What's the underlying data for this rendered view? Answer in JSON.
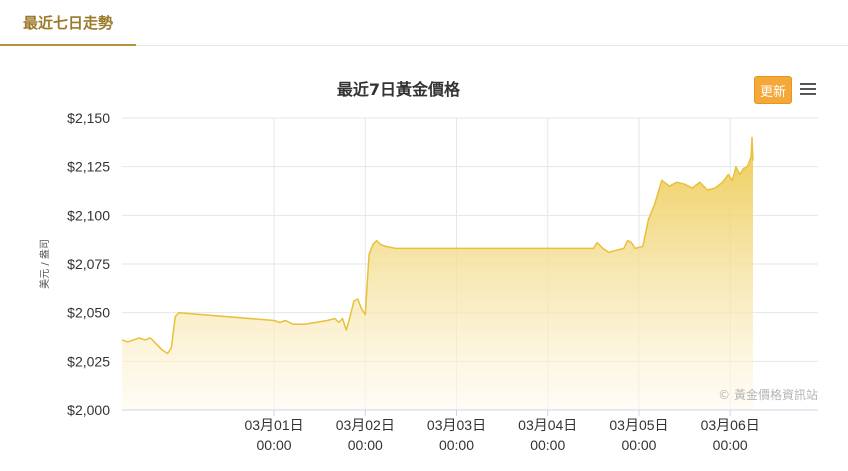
{
  "tab": {
    "label": "最近七日走勢"
  },
  "toolbar": {
    "update_label": "更新",
    "menu_icon": "hamburger-menu-icon"
  },
  "credits": "© 黃金價格資訊站",
  "colors": {
    "line": "#e8c13a",
    "fill_top": "#ecc84a",
    "fill_bottom": "#fffaf0",
    "accent": "#f4a83a",
    "tab": "#b8913a"
  },
  "chart_data": {
    "type": "area",
    "title": "最近7日黃金價格",
    "ylabel": "美元 / 盎司",
    "xlabel": "",
    "ylim": [
      2000,
      2150
    ],
    "yticks": [
      {
        "value": 2000,
        "label": "$2,000"
      },
      {
        "value": 2025,
        "label": "$2,025"
      },
      {
        "value": 2050,
        "label": "$2,050"
      },
      {
        "value": 2075,
        "label": "$2,075"
      },
      {
        "value": 2100,
        "label": "$2,100"
      },
      {
        "value": 2125,
        "label": "$2,125"
      },
      {
        "value": 2150,
        "label": "$2,150"
      }
    ],
    "xlim": [
      "02-29 08:00",
      "03-06 06:00"
    ],
    "xticks": [
      {
        "value": "03-01 00:00",
        "line1": "03月01日",
        "line2": "00:00"
      },
      {
        "value": "03-02 00:00",
        "line1": "03月02日",
        "line2": "00:00"
      },
      {
        "value": "03-03 00:00",
        "line1": "03月03日",
        "line2": "00:00"
      },
      {
        "value": "03-04 00:00",
        "line1": "03月04日",
        "line2": "00:00"
      },
      {
        "value": "03-05 00:00",
        "line1": "03月05日",
        "line2": "00:00"
      },
      {
        "value": "03-06 00:00",
        "line1": "03月06日",
        "line2": "00:00"
      }
    ],
    "grid": true,
    "series": [
      {
        "x": [
          "02-29 08:00",
          "02-29 09:30",
          "02-29 11:00",
          "02-29 12:30",
          "02-29 14:00",
          "02-29 15:30",
          "02-29 17:00",
          "02-29 18:30",
          "02-29 20:00",
          "02-29 21:00",
          "02-29 22:00",
          "02-29 23:00",
          "03-01 00:00",
          "03-01 01:30",
          "03-01 03:00",
          "03-01 05:00",
          "03-01 08:00",
          "03-01 11:00",
          "03-01 14:00",
          "03-01 16:00",
          "03-01 17:00",
          "03-01 18:00",
          "03-01 19:00",
          "03-01 20:00",
          "03-01 21:00",
          "03-01 22:00",
          "03-01 23:00",
          "03-02 00:00",
          "03-02 00:30",
          "03-02 01:00",
          "03-02 02:00",
          "03-02 03:00",
          "03-02 04:00",
          "03-02 05:30",
          "03-02 08:00",
          "03-03 12:00",
          "03-04 12:00",
          "03-04 13:00",
          "03-04 14:30",
          "03-04 16:00",
          "03-04 18:00",
          "03-04 20:00",
          "03-04 21:00",
          "03-04 22:00",
          "03-04 23:00",
          "03-05 01:00",
          "03-05 02:30",
          "03-05 04:00",
          "03-05 06:00",
          "03-05 08:00",
          "03-05 10:00",
          "03-05 12:00",
          "03-05 14:00",
          "03-05 16:00",
          "03-05 18:00",
          "03-05 20:00",
          "03-05 22:00",
          "03-05 23:30",
          "03-06 00:30",
          "03-06 01:00",
          "03-06 01:30",
          "03-06 02:30",
          "03-06 03:30",
          "03-06 04:30",
          "03-06 05:30",
          "03-06 05:45",
          "03-06 06:00"
        ],
        "y": [
          2036,
          2035,
          2036,
          2037,
          2036,
          2037,
          2034,
          2031,
          2029,
          2032,
          2048,
          2050,
          2046,
          2045,
          2046,
          2044,
          2044,
          2045,
          2046,
          2047,
          2045,
          2047,
          2041,
          2048,
          2056,
          2057,
          2052,
          2049,
          2065,
          2080,
          2085,
          2087,
          2085,
          2084,
          2083,
          2083,
          2083,
          2086,
          2083,
          2081,
          2082,
          2083,
          2087,
          2086,
          2083,
          2084,
          2098,
          2105,
          2118,
          2115,
          2117,
          2116,
          2114,
          2117,
          2113,
          2114,
          2117,
          2121,
          2118,
          2121,
          2125,
          2121,
          2124,
          2125,
          2130,
          2140,
          2128
        ]
      }
    ]
  }
}
